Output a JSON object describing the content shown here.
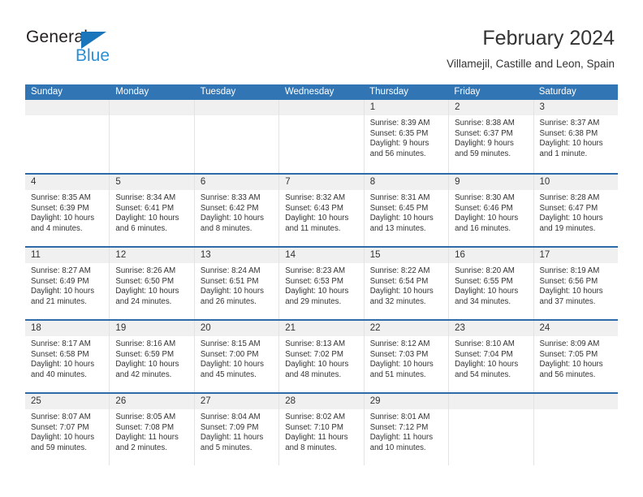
{
  "brand": {
    "word1": "General",
    "word2": "Blue",
    "triangle_color": "#1b75bb",
    "blue_color": "#2a8fd4"
  },
  "header": {
    "title": "February 2024",
    "subtitle": "Villamejil, Castille and Leon, Spain"
  },
  "theme": {
    "header_blue": "#3175b4",
    "row_rule_blue": "#2d6ca8",
    "daynum_band": "#f0f0f0",
    "cell_border": "#e3e3e3"
  },
  "calendar": {
    "weekday_headers": [
      "Sunday",
      "Monday",
      "Tuesday",
      "Wednesday",
      "Thursday",
      "Friday",
      "Saturday"
    ],
    "weeks": [
      [
        {
          "day": "",
          "lines": []
        },
        {
          "day": "",
          "lines": []
        },
        {
          "day": "",
          "lines": []
        },
        {
          "day": "",
          "lines": []
        },
        {
          "day": "1",
          "lines": [
            "Sunrise: 8:39 AM",
            "Sunset: 6:35 PM",
            "Daylight: 9 hours",
            "and 56 minutes."
          ]
        },
        {
          "day": "2",
          "lines": [
            "Sunrise: 8:38 AM",
            "Sunset: 6:37 PM",
            "Daylight: 9 hours",
            "and 59 minutes."
          ]
        },
        {
          "day": "3",
          "lines": [
            "Sunrise: 8:37 AM",
            "Sunset: 6:38 PM",
            "Daylight: 10 hours",
            "and 1 minute."
          ]
        }
      ],
      [
        {
          "day": "4",
          "lines": [
            "Sunrise: 8:35 AM",
            "Sunset: 6:39 PM",
            "Daylight: 10 hours",
            "and 4 minutes."
          ]
        },
        {
          "day": "5",
          "lines": [
            "Sunrise: 8:34 AM",
            "Sunset: 6:41 PM",
            "Daylight: 10 hours",
            "and 6 minutes."
          ]
        },
        {
          "day": "6",
          "lines": [
            "Sunrise: 8:33 AM",
            "Sunset: 6:42 PM",
            "Daylight: 10 hours",
            "and 8 minutes."
          ]
        },
        {
          "day": "7",
          "lines": [
            "Sunrise: 8:32 AM",
            "Sunset: 6:43 PM",
            "Daylight: 10 hours",
            "and 11 minutes."
          ]
        },
        {
          "day": "8",
          "lines": [
            "Sunrise: 8:31 AM",
            "Sunset: 6:45 PM",
            "Daylight: 10 hours",
            "and 13 minutes."
          ]
        },
        {
          "day": "9",
          "lines": [
            "Sunrise: 8:30 AM",
            "Sunset: 6:46 PM",
            "Daylight: 10 hours",
            "and 16 minutes."
          ]
        },
        {
          "day": "10",
          "lines": [
            "Sunrise: 8:28 AM",
            "Sunset: 6:47 PM",
            "Daylight: 10 hours",
            "and 19 minutes."
          ]
        }
      ],
      [
        {
          "day": "11",
          "lines": [
            "Sunrise: 8:27 AM",
            "Sunset: 6:49 PM",
            "Daylight: 10 hours",
            "and 21 minutes."
          ]
        },
        {
          "day": "12",
          "lines": [
            "Sunrise: 8:26 AM",
            "Sunset: 6:50 PM",
            "Daylight: 10 hours",
            "and 24 minutes."
          ]
        },
        {
          "day": "13",
          "lines": [
            "Sunrise: 8:24 AM",
            "Sunset: 6:51 PM",
            "Daylight: 10 hours",
            "and 26 minutes."
          ]
        },
        {
          "day": "14",
          "lines": [
            "Sunrise: 8:23 AM",
            "Sunset: 6:53 PM",
            "Daylight: 10 hours",
            "and 29 minutes."
          ]
        },
        {
          "day": "15",
          "lines": [
            "Sunrise: 8:22 AM",
            "Sunset: 6:54 PM",
            "Daylight: 10 hours",
            "and 32 minutes."
          ]
        },
        {
          "day": "16",
          "lines": [
            "Sunrise: 8:20 AM",
            "Sunset: 6:55 PM",
            "Daylight: 10 hours",
            "and 34 minutes."
          ]
        },
        {
          "day": "17",
          "lines": [
            "Sunrise: 8:19 AM",
            "Sunset: 6:56 PM",
            "Daylight: 10 hours",
            "and 37 minutes."
          ]
        }
      ],
      [
        {
          "day": "18",
          "lines": [
            "Sunrise: 8:17 AM",
            "Sunset: 6:58 PM",
            "Daylight: 10 hours",
            "and 40 minutes."
          ]
        },
        {
          "day": "19",
          "lines": [
            "Sunrise: 8:16 AM",
            "Sunset: 6:59 PM",
            "Daylight: 10 hours",
            "and 42 minutes."
          ]
        },
        {
          "day": "20",
          "lines": [
            "Sunrise: 8:15 AM",
            "Sunset: 7:00 PM",
            "Daylight: 10 hours",
            "and 45 minutes."
          ]
        },
        {
          "day": "21",
          "lines": [
            "Sunrise: 8:13 AM",
            "Sunset: 7:02 PM",
            "Daylight: 10 hours",
            "and 48 minutes."
          ]
        },
        {
          "day": "22",
          "lines": [
            "Sunrise: 8:12 AM",
            "Sunset: 7:03 PM",
            "Daylight: 10 hours",
            "and 51 minutes."
          ]
        },
        {
          "day": "23",
          "lines": [
            "Sunrise: 8:10 AM",
            "Sunset: 7:04 PM",
            "Daylight: 10 hours",
            "and 54 minutes."
          ]
        },
        {
          "day": "24",
          "lines": [
            "Sunrise: 8:09 AM",
            "Sunset: 7:05 PM",
            "Daylight: 10 hours",
            "and 56 minutes."
          ]
        }
      ],
      [
        {
          "day": "25",
          "lines": [
            "Sunrise: 8:07 AM",
            "Sunset: 7:07 PM",
            "Daylight: 10 hours",
            "and 59 minutes."
          ]
        },
        {
          "day": "26",
          "lines": [
            "Sunrise: 8:05 AM",
            "Sunset: 7:08 PM",
            "Daylight: 11 hours",
            "and 2 minutes."
          ]
        },
        {
          "day": "27",
          "lines": [
            "Sunrise: 8:04 AM",
            "Sunset: 7:09 PM",
            "Daylight: 11 hours",
            "and 5 minutes."
          ]
        },
        {
          "day": "28",
          "lines": [
            "Sunrise: 8:02 AM",
            "Sunset: 7:10 PM",
            "Daylight: 11 hours",
            "and 8 minutes."
          ]
        },
        {
          "day": "29",
          "lines": [
            "Sunrise: 8:01 AM",
            "Sunset: 7:12 PM",
            "Daylight: 11 hours",
            "and 10 minutes."
          ]
        },
        {
          "day": "",
          "lines": []
        },
        {
          "day": "",
          "lines": []
        }
      ]
    ]
  }
}
